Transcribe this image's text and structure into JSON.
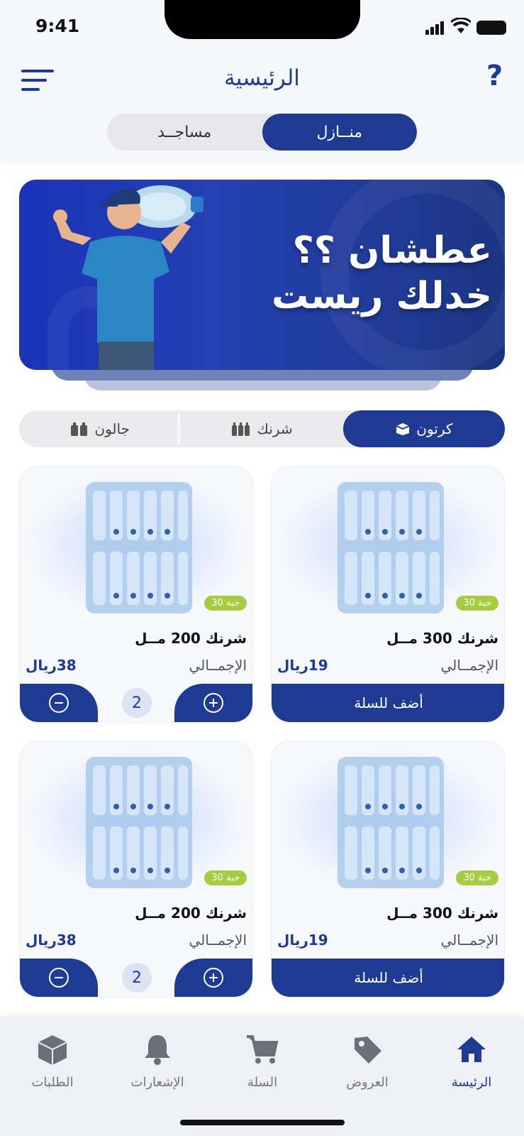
{
  "status_bar": {
    "time": "9:41"
  },
  "header": {
    "title": "الرئيسية",
    "help_label": "?"
  },
  "segment": {
    "homes_label": "منــازل",
    "mosques_label": "مساجــد",
    "selected": "منــازل"
  },
  "banner": {
    "line1": "عطشان ؟؟",
    "line2": "خدلك ريست"
  },
  "filters": [
    {
      "label": "كرتون",
      "icon": "box-icon",
      "active": true
    },
    {
      "label": "شرنك",
      "icon": "bottles-icon",
      "active": false
    },
    {
      "label": "جالون",
      "icon": "gallon-icon",
      "active": false
    }
  ],
  "products": [
    {
      "name": "شرنك 300 مــل",
      "badge": "30 حبة",
      "total_label": "الإجمــالي",
      "price": "19ريال",
      "action": "أضف للسلة"
    },
    {
      "name": "شرنك 200 مــل",
      "badge": "30 حبة",
      "total_label": "الإجمــالي",
      "price": "38ريال",
      "quantity": "2"
    },
    {
      "name": "شرنك 300 مــل",
      "badge": "30 حبة",
      "total_label": "الإجمــالي",
      "price": "19ريال",
      "action": "أضف للسلة"
    },
    {
      "name": "شرنك 200 مــل",
      "badge": "30 حبة",
      "total_label": "الإجمــالي",
      "price": "38ريال",
      "quantity": "2"
    }
  ],
  "tabbar": [
    {
      "label": "الرئيسة",
      "icon": "home-icon",
      "active": true
    },
    {
      "label": "العروض",
      "icon": "tag-icon",
      "active": false
    },
    {
      "label": "السلة",
      "icon": "cart-icon",
      "active": false
    },
    {
      "label": "الإشعارات",
      "icon": "bell-icon",
      "active": false
    },
    {
      "label": "الطلبات",
      "icon": "package-icon",
      "active": false
    }
  ],
  "colors": {
    "primary": "#1f3a93",
    "badge_green": "#a6cc3f",
    "background": "#ffffff"
  }
}
